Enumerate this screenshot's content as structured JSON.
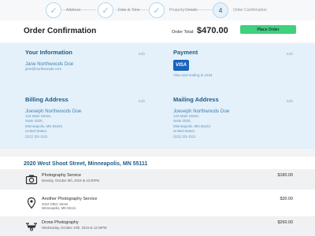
{
  "stepper": {
    "steps": [
      {
        "label": "Address",
        "marker": "✓"
      },
      {
        "label": "Date & Time",
        "marker": "✓"
      },
      {
        "label": "Property Details",
        "marker": "✓"
      },
      {
        "label": "Order Confirmation",
        "marker": "4"
      }
    ]
  },
  "header": {
    "title": "Order Confirmation",
    "total_label": "Order Total:",
    "total_amount": "$470.00",
    "place_order_label": "Place Order"
  },
  "your_information": {
    "heading": "Your Information",
    "edit_label": "Edit",
    "name": "Jane Northwoods Doe",
    "email": "jane@northwoods.com"
  },
  "payment": {
    "heading": "Payment",
    "edit_label": "Edit",
    "card_brand": "VISA",
    "card_text": "Visa card ending in 1234"
  },
  "billing_address": {
    "heading": "Billing Address",
    "edit_label": "Edit",
    "name": "Joeseph Northwoods Doe",
    "lines": [
      "123 Main Street,",
      "Suite 2020,",
      "Minneapolis, MN 55441",
      "United States",
      "(111) 111-1111"
    ]
  },
  "mailing_address": {
    "heading": "Mailing Address",
    "edit_label": "Edit",
    "name": "Joeseph Northwoods Doe",
    "lines": [
      "123 Main Street,",
      "Suite 2020,",
      "Minneapolis, MN 55441",
      "United States",
      "(111) 111-1111"
    ]
  },
  "shipment": {
    "address": "2020 West Shoot Street, Minneapolis, MN 55111",
    "items": [
      {
        "icon": "camera-icon",
        "title": "Photography Service",
        "lines": [
          "Monday, October 8th, 2019 at 10:00PM"
        ],
        "price": "$180.00"
      },
      {
        "icon": "map-pin-icon",
        "title": "Another Photography Service",
        "lines": [
          "2010 Other Street",
          "Minneapolis, MN 55111"
        ],
        "price": "$30.00"
      },
      {
        "icon": "drone-icon",
        "title": "Drone Photography",
        "lines": [
          "Wednesday, October 10th, 2019 at 12:00PM"
        ],
        "price": "$260.00"
      }
    ]
  },
  "colors": {
    "accent_blue": "#1f5d84",
    "link_blue": "#3a84b6",
    "panel_bg": "#e4f0fa",
    "place_order_green": "#3ed17e"
  }
}
